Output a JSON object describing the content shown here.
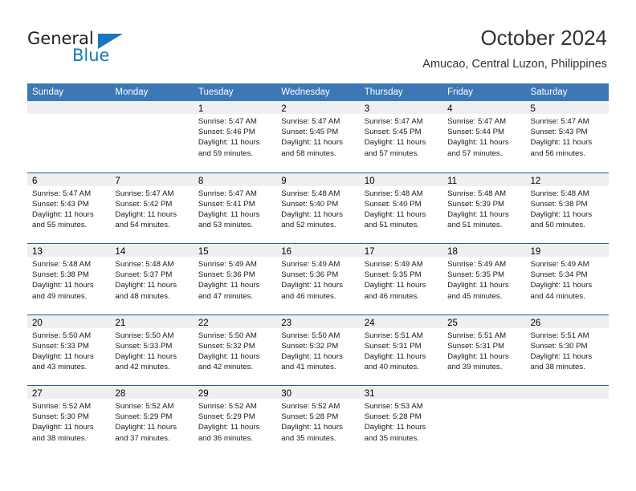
{
  "brand": {
    "name_part1": "General",
    "name_part2": "Blue",
    "accent_color": "#1878be"
  },
  "header": {
    "title": "October 2024",
    "subtitle": "Amucao, Central Luzon, Philippines"
  },
  "theme": {
    "header_row_color": "#3b78b5",
    "week_divider_color": "#1f5fa0",
    "daynum_band_color": "#efefef"
  },
  "weekday_headers": [
    "Sunday",
    "Monday",
    "Tuesday",
    "Wednesday",
    "Thursday",
    "Friday",
    "Saturday"
  ],
  "weeks": [
    [
      {
        "day": "",
        "sunrise": "",
        "sunset": "",
        "daylight": "",
        "daylight2": ""
      },
      {
        "day": "",
        "sunrise": "",
        "sunset": "",
        "daylight": "",
        "daylight2": ""
      },
      {
        "day": "1",
        "sunrise": "Sunrise: 5:47 AM",
        "sunset": "Sunset: 5:46 PM",
        "daylight": "Daylight: 11 hours",
        "daylight2": "and 59 minutes."
      },
      {
        "day": "2",
        "sunrise": "Sunrise: 5:47 AM",
        "sunset": "Sunset: 5:45 PM",
        "daylight": "Daylight: 11 hours",
        "daylight2": "and 58 minutes."
      },
      {
        "day": "3",
        "sunrise": "Sunrise: 5:47 AM",
        "sunset": "Sunset: 5:45 PM",
        "daylight": "Daylight: 11 hours",
        "daylight2": "and 57 minutes."
      },
      {
        "day": "4",
        "sunrise": "Sunrise: 5:47 AM",
        "sunset": "Sunset: 5:44 PM",
        "daylight": "Daylight: 11 hours",
        "daylight2": "and 57 minutes."
      },
      {
        "day": "5",
        "sunrise": "Sunrise: 5:47 AM",
        "sunset": "Sunset: 5:43 PM",
        "daylight": "Daylight: 11 hours",
        "daylight2": "and 56 minutes."
      }
    ],
    [
      {
        "day": "6",
        "sunrise": "Sunrise: 5:47 AM",
        "sunset": "Sunset: 5:43 PM",
        "daylight": "Daylight: 11 hours",
        "daylight2": "and 55 minutes."
      },
      {
        "day": "7",
        "sunrise": "Sunrise: 5:47 AM",
        "sunset": "Sunset: 5:42 PM",
        "daylight": "Daylight: 11 hours",
        "daylight2": "and 54 minutes."
      },
      {
        "day": "8",
        "sunrise": "Sunrise: 5:47 AM",
        "sunset": "Sunset: 5:41 PM",
        "daylight": "Daylight: 11 hours",
        "daylight2": "and 53 minutes."
      },
      {
        "day": "9",
        "sunrise": "Sunrise: 5:48 AM",
        "sunset": "Sunset: 5:40 PM",
        "daylight": "Daylight: 11 hours",
        "daylight2": "and 52 minutes."
      },
      {
        "day": "10",
        "sunrise": "Sunrise: 5:48 AM",
        "sunset": "Sunset: 5:40 PM",
        "daylight": "Daylight: 11 hours",
        "daylight2": "and 51 minutes."
      },
      {
        "day": "11",
        "sunrise": "Sunrise: 5:48 AM",
        "sunset": "Sunset: 5:39 PM",
        "daylight": "Daylight: 11 hours",
        "daylight2": "and 51 minutes."
      },
      {
        "day": "12",
        "sunrise": "Sunrise: 5:48 AM",
        "sunset": "Sunset: 5:38 PM",
        "daylight": "Daylight: 11 hours",
        "daylight2": "and 50 minutes."
      }
    ],
    [
      {
        "day": "13",
        "sunrise": "Sunrise: 5:48 AM",
        "sunset": "Sunset: 5:38 PM",
        "daylight": "Daylight: 11 hours",
        "daylight2": "and 49 minutes."
      },
      {
        "day": "14",
        "sunrise": "Sunrise: 5:48 AM",
        "sunset": "Sunset: 5:37 PM",
        "daylight": "Daylight: 11 hours",
        "daylight2": "and 48 minutes."
      },
      {
        "day": "15",
        "sunrise": "Sunrise: 5:49 AM",
        "sunset": "Sunset: 5:36 PM",
        "daylight": "Daylight: 11 hours",
        "daylight2": "and 47 minutes."
      },
      {
        "day": "16",
        "sunrise": "Sunrise: 5:49 AM",
        "sunset": "Sunset: 5:36 PM",
        "daylight": "Daylight: 11 hours",
        "daylight2": "and 46 minutes."
      },
      {
        "day": "17",
        "sunrise": "Sunrise: 5:49 AM",
        "sunset": "Sunset: 5:35 PM",
        "daylight": "Daylight: 11 hours",
        "daylight2": "and 46 minutes."
      },
      {
        "day": "18",
        "sunrise": "Sunrise: 5:49 AM",
        "sunset": "Sunset: 5:35 PM",
        "daylight": "Daylight: 11 hours",
        "daylight2": "and 45 minutes."
      },
      {
        "day": "19",
        "sunrise": "Sunrise: 5:49 AM",
        "sunset": "Sunset: 5:34 PM",
        "daylight": "Daylight: 11 hours",
        "daylight2": "and 44 minutes."
      }
    ],
    [
      {
        "day": "20",
        "sunrise": "Sunrise: 5:50 AM",
        "sunset": "Sunset: 5:33 PM",
        "daylight": "Daylight: 11 hours",
        "daylight2": "and 43 minutes."
      },
      {
        "day": "21",
        "sunrise": "Sunrise: 5:50 AM",
        "sunset": "Sunset: 5:33 PM",
        "daylight": "Daylight: 11 hours",
        "daylight2": "and 42 minutes."
      },
      {
        "day": "22",
        "sunrise": "Sunrise: 5:50 AM",
        "sunset": "Sunset: 5:32 PM",
        "daylight": "Daylight: 11 hours",
        "daylight2": "and 42 minutes."
      },
      {
        "day": "23",
        "sunrise": "Sunrise: 5:50 AM",
        "sunset": "Sunset: 5:32 PM",
        "daylight": "Daylight: 11 hours",
        "daylight2": "and 41 minutes."
      },
      {
        "day": "24",
        "sunrise": "Sunrise: 5:51 AM",
        "sunset": "Sunset: 5:31 PM",
        "daylight": "Daylight: 11 hours",
        "daylight2": "and 40 minutes."
      },
      {
        "day": "25",
        "sunrise": "Sunrise: 5:51 AM",
        "sunset": "Sunset: 5:31 PM",
        "daylight": "Daylight: 11 hours",
        "daylight2": "and 39 minutes."
      },
      {
        "day": "26",
        "sunrise": "Sunrise: 5:51 AM",
        "sunset": "Sunset: 5:30 PM",
        "daylight": "Daylight: 11 hours",
        "daylight2": "and 38 minutes."
      }
    ],
    [
      {
        "day": "27",
        "sunrise": "Sunrise: 5:52 AM",
        "sunset": "Sunset: 5:30 PM",
        "daylight": "Daylight: 11 hours",
        "daylight2": "and 38 minutes."
      },
      {
        "day": "28",
        "sunrise": "Sunrise: 5:52 AM",
        "sunset": "Sunset: 5:29 PM",
        "daylight": "Daylight: 11 hours",
        "daylight2": "and 37 minutes."
      },
      {
        "day": "29",
        "sunrise": "Sunrise: 5:52 AM",
        "sunset": "Sunset: 5:29 PM",
        "daylight": "Daylight: 11 hours",
        "daylight2": "and 36 minutes."
      },
      {
        "day": "30",
        "sunrise": "Sunrise: 5:52 AM",
        "sunset": "Sunset: 5:28 PM",
        "daylight": "Daylight: 11 hours",
        "daylight2": "and 35 minutes."
      },
      {
        "day": "31",
        "sunrise": "Sunrise: 5:53 AM",
        "sunset": "Sunset: 5:28 PM",
        "daylight": "Daylight: 11 hours",
        "daylight2": "and 35 minutes."
      },
      {
        "day": "",
        "sunrise": "",
        "sunset": "",
        "daylight": "",
        "daylight2": ""
      },
      {
        "day": "",
        "sunrise": "",
        "sunset": "",
        "daylight": "",
        "daylight2": ""
      }
    ]
  ]
}
